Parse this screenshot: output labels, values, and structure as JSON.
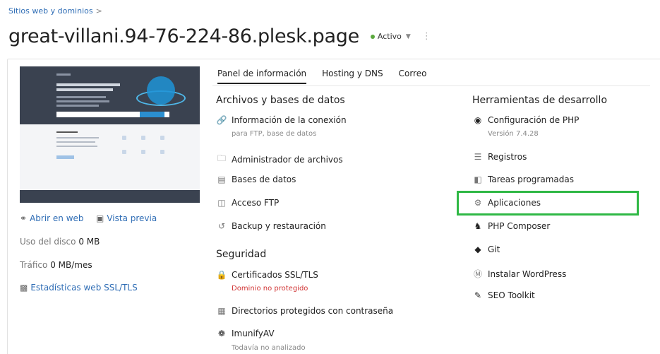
{
  "breadcrumb": {
    "label": "Sitios web y dominios",
    "sep": ">"
  },
  "header": {
    "title": "great-villani.94-76-224-86.plesk.page",
    "status": "Activo",
    "status_color": "#5aa83d"
  },
  "left": {
    "open_web": "Abrir en web",
    "preview": "Vista previa",
    "disk_label": "Uso del disco",
    "disk_value": "0 MB",
    "traffic_label": "Tráfico",
    "traffic_value": "0 MB/mes",
    "stats": "Estadísticas web SSL/TLS"
  },
  "tabs": [
    "Panel de información",
    "Hosting y DNS",
    "Correo"
  ],
  "files": {
    "title": "Archivos y bases de datos",
    "items": [
      {
        "label": "Información de la conexión",
        "sub": "para FTP, base de datos",
        "icon": "link-icon"
      },
      {
        "label": "Administrador de archivos",
        "icon": "folder-icon"
      },
      {
        "label": "Bases de datos",
        "icon": "database-icon"
      },
      {
        "label": "Acceso FTP",
        "icon": "ftp-icon"
      },
      {
        "label": "Backup y restauración",
        "icon": "backup-icon"
      }
    ]
  },
  "security": {
    "title": "Seguridad",
    "items": [
      {
        "label": "Certificados SSL/TLS",
        "sub": "Dominio no protegido",
        "icon": "certificate-icon"
      },
      {
        "label": "Directorios protegidos con contraseña",
        "icon": "protected-folder-icon"
      },
      {
        "label": "ImunifyAV",
        "sub": "Todavía no analizado",
        "icon": "imunify-icon"
      }
    ]
  },
  "dev": {
    "title": "Herramientas de desarrollo",
    "items": [
      {
        "label": "Configuración de PHP",
        "sub": "Versión 7.4.28",
        "icon": "php-icon"
      },
      {
        "label": "Registros",
        "icon": "logs-icon"
      },
      {
        "label": "Tareas programadas",
        "icon": "calendar-icon"
      },
      {
        "label": "Aplicaciones",
        "icon": "gear-icon"
      },
      {
        "label": "PHP Composer",
        "icon": "composer-icon"
      },
      {
        "label": "Git",
        "icon": "git-icon"
      },
      {
        "label": "Instalar WordPress",
        "icon": "wordpress-icon"
      },
      {
        "label": "SEO Toolkit",
        "icon": "seo-icon"
      }
    ]
  },
  "colors": {
    "link": "#2f6db5",
    "warn": "#d13636",
    "highlight": "#2fb845"
  }
}
